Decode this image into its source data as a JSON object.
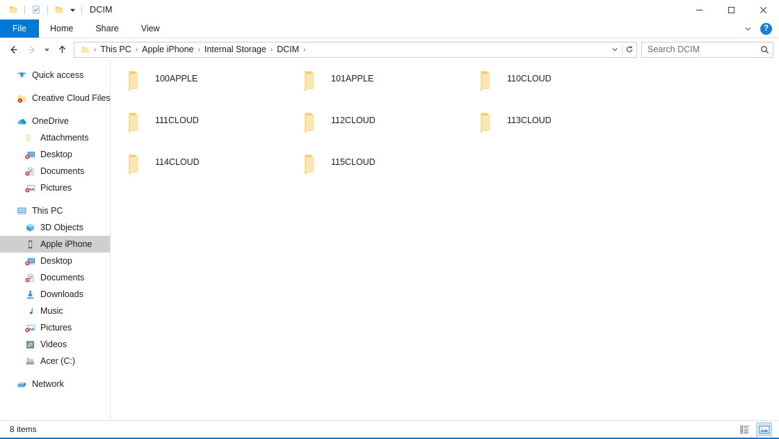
{
  "window": {
    "title": "DCIM",
    "quick_access_toolbar": [
      {
        "name": "folder-icon",
        "label": "Folder"
      },
      {
        "name": "properties-icon",
        "label": "Properties"
      },
      {
        "name": "new-folder-icon",
        "label": "New folder"
      },
      {
        "name": "chevron-down-icon",
        "label": "Customize Quick Access Toolbar"
      }
    ],
    "controls": {
      "minimize": "—",
      "maximize": "☐",
      "close": "✕"
    }
  },
  "ribbon": {
    "tabs": [
      {
        "label": "File",
        "active": true
      },
      {
        "label": "Home",
        "active": false
      },
      {
        "label": "Share",
        "active": false
      },
      {
        "label": "View",
        "active": false
      }
    ],
    "expand_icon": "chevron-down-icon",
    "help_label": "?"
  },
  "navigation": {
    "back": "←",
    "forward": "→",
    "recent": "⌄",
    "up": "↑",
    "breadcrumbs": [
      "This PC",
      "Apple iPhone",
      "Internal Storage",
      "DCIM"
    ],
    "separator": "›",
    "dropdown_icon": "chevron-down-icon",
    "refresh_icon": "↻"
  },
  "search": {
    "placeholder": "Search DCIM",
    "value": "",
    "icon": "search-icon"
  },
  "sidebar": {
    "items": [
      {
        "label": "Quick access",
        "icon": "star-icon",
        "level": 0,
        "selected": false,
        "gap_before": false
      },
      {
        "label": "Creative Cloud Files",
        "icon": "creative-cloud-folder-icon",
        "level": 0,
        "selected": false,
        "gap_before": true
      },
      {
        "label": "OneDrive",
        "icon": "onedrive-cloud-icon",
        "level": 0,
        "selected": false,
        "gap_before": true
      },
      {
        "label": "Attachments",
        "icon": "folder-icon",
        "level": 1,
        "selected": false,
        "gap_before": false
      },
      {
        "label": "Desktop",
        "icon": "desktop-sync-error-icon",
        "level": 1,
        "selected": false,
        "gap_before": false
      },
      {
        "label": "Documents",
        "icon": "documents-sync-error-icon",
        "level": 1,
        "selected": false,
        "gap_before": false
      },
      {
        "label": "Pictures",
        "icon": "pictures-sync-error-icon",
        "level": 1,
        "selected": false,
        "gap_before": false
      },
      {
        "label": "This PC",
        "icon": "this-pc-icon",
        "level": 0,
        "selected": false,
        "gap_before": true
      },
      {
        "label": "3D Objects",
        "icon": "3d-objects-icon",
        "level": 1,
        "selected": false,
        "gap_before": false
      },
      {
        "label": "Apple iPhone",
        "icon": "phone-icon",
        "level": 1,
        "selected": true,
        "gap_before": false
      },
      {
        "label": "Desktop",
        "icon": "desktop-sync-error-icon",
        "level": 1,
        "selected": false,
        "gap_before": false
      },
      {
        "label": "Documents",
        "icon": "documents-sync-error-icon",
        "level": 1,
        "selected": false,
        "gap_before": false
      },
      {
        "label": "Downloads",
        "icon": "downloads-icon",
        "level": 1,
        "selected": false,
        "gap_before": false
      },
      {
        "label": "Music",
        "icon": "music-note-icon",
        "level": 1,
        "selected": false,
        "gap_before": false
      },
      {
        "label": "Pictures",
        "icon": "pictures-sync-error-icon",
        "level": 1,
        "selected": false,
        "gap_before": false
      },
      {
        "label": "Videos",
        "icon": "videos-icon",
        "level": 1,
        "selected": false,
        "gap_before": false
      },
      {
        "label": "Acer (C:)",
        "icon": "hard-drive-icon",
        "level": 1,
        "selected": false,
        "gap_before": false
      },
      {
        "label": "Network",
        "icon": "network-icon",
        "level": 0,
        "selected": false,
        "gap_before": true
      }
    ]
  },
  "files": [
    {
      "name": "100APPLE",
      "icon": "folder-icon"
    },
    {
      "name": "101APPLE",
      "icon": "folder-icon"
    },
    {
      "name": "110CLOUD",
      "icon": "folder-icon"
    },
    {
      "name": "111CLOUD",
      "icon": "folder-icon"
    },
    {
      "name": "112CLOUD",
      "icon": "folder-icon"
    },
    {
      "name": "113CLOUD",
      "icon": "folder-icon"
    },
    {
      "name": "114CLOUD",
      "icon": "folder-icon"
    },
    {
      "name": "115CLOUD",
      "icon": "folder-icon"
    }
  ],
  "statusbar": {
    "item_count": "8 items",
    "view_buttons": [
      {
        "name": "details-view-button",
        "active": false
      },
      {
        "name": "large-icons-view-button",
        "active": true
      }
    ]
  },
  "colors": {
    "accent": "#0078d7",
    "folder_yellow": "#f5d77a",
    "selection_gray": "#cfcfcf"
  }
}
